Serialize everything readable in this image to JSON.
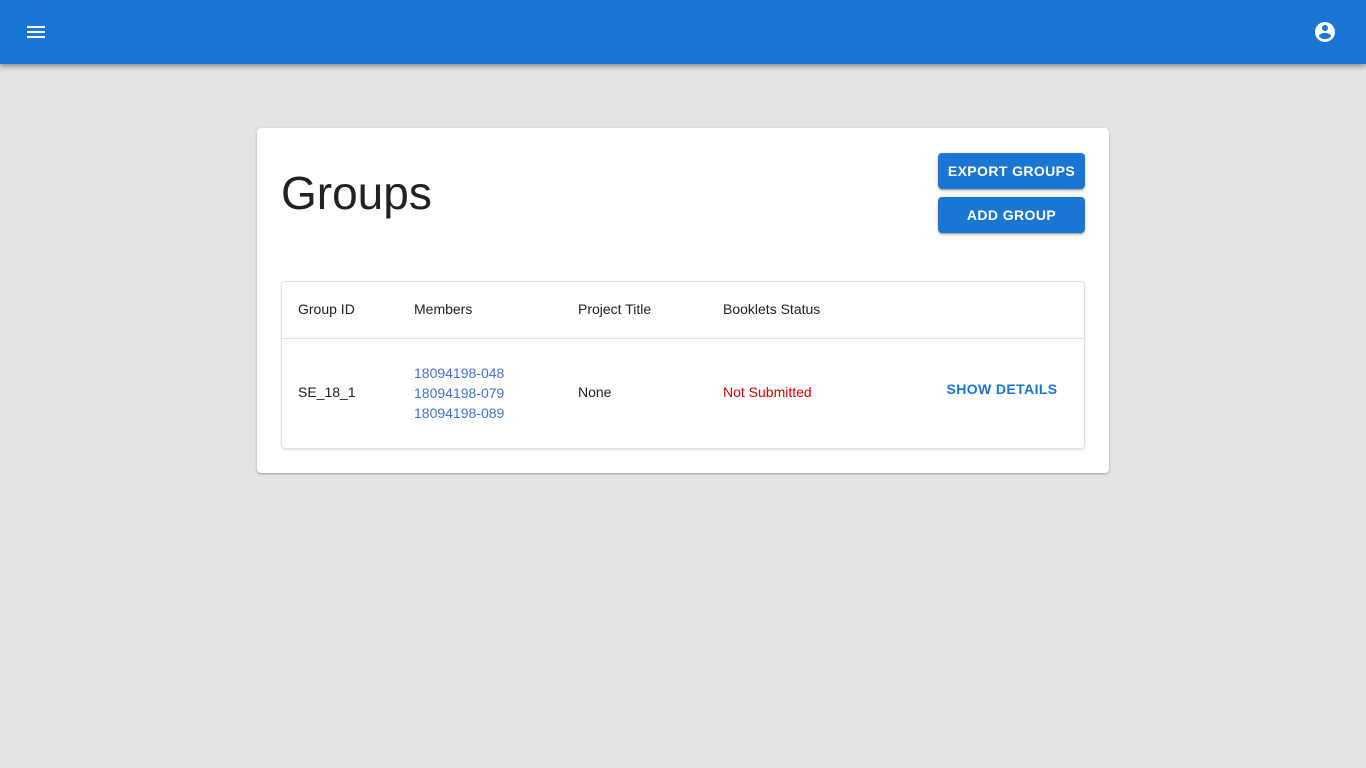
{
  "appbar": {
    "menu_icon": "menu-icon",
    "account_icon": "account-circle-icon",
    "color": "#1976d2"
  },
  "page": {
    "title": "Groups",
    "export_button": "Export Groups",
    "add_button": "Add Group"
  },
  "table": {
    "headers": {
      "group_id": "Group ID",
      "members": "Members",
      "project_title": "Project Title",
      "booklets_status": "Booklets Status"
    },
    "rows": [
      {
        "group_id": "SE_18_1",
        "members": [
          "18094198-048",
          "18094198-079",
          "18094198-089"
        ],
        "project_title": "None",
        "booklets_status": "Not Submitted",
        "action": "Show Details"
      }
    ]
  },
  "colors": {
    "background": "#e4e4e4",
    "primary": "#1976d2",
    "link": "#3f73d1",
    "status_error": "#d50000"
  }
}
